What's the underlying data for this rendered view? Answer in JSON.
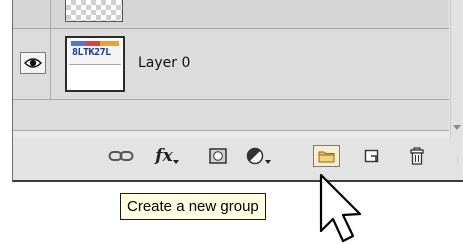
{
  "layers_panel": {
    "layers": [
      {
        "name": "",
        "visible": true,
        "thumbnail": "transparency-checkerboard"
      },
      {
        "name": "Layer 0",
        "visible": true,
        "thumbnail": "license-plate-image",
        "thumbnail_text": "8LTK27L"
      }
    ]
  },
  "toolbar": {
    "buttons": [
      {
        "icon": "link-layers-icon"
      },
      {
        "icon": "fx-icon",
        "label": "fx"
      },
      {
        "icon": "layer-mask-icon"
      },
      {
        "icon": "adjustment-layer-icon"
      },
      {
        "icon": "new-group-folder-icon",
        "pressed": true
      },
      {
        "icon": "new-layer-icon"
      },
      {
        "icon": "trash-icon"
      }
    ]
  },
  "tooltip": {
    "text": "Create a new group"
  },
  "colors": {
    "panel_bg": "#e9e9e9",
    "row_bg": "#dcdcdc",
    "tooltip_bg": "#ffffe1",
    "folder": "#e8c25a"
  }
}
